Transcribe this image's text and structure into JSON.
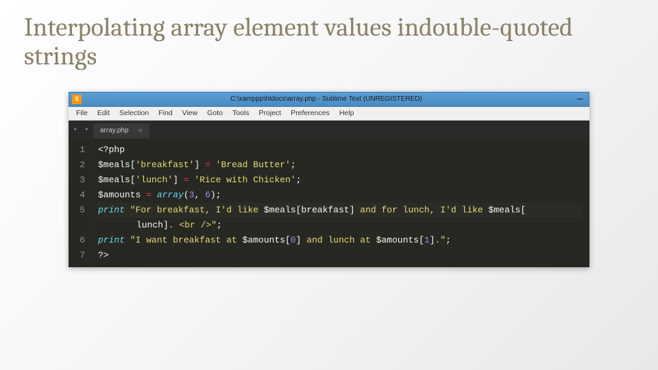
{
  "slide": {
    "title": "Interpolating array element values indouble-quoted strings"
  },
  "editor": {
    "titlebar": {
      "icon_label": "S",
      "path": "C:\\xamppp\\htdocs\\array.php - Sublime Text (UNREGISTERED)",
      "minimize": "—"
    },
    "menu": {
      "items": [
        "File",
        "Edit",
        "Selection",
        "Find",
        "View",
        "Goto",
        "Tools",
        "Project",
        "Preferences",
        "Help"
      ]
    },
    "tab": {
      "nav_prev": "◂",
      "nav_next": "▸",
      "name": "array.php",
      "close": "×"
    },
    "line_numbers": [
      "1",
      "2",
      "3",
      "4",
      "5",
      "",
      "6",
      "7"
    ],
    "code": {
      "l1_open": "<?php",
      "l2_var": "$meals",
      "l2_br_open": "[",
      "l2_key": "'breakfast'",
      "l2_br_close": "]",
      "l2_eq": " = ",
      "l2_val": "'Bread Butter'",
      "l2_semi": ";",
      "l3_var": "$meals",
      "l3_br_open": "[",
      "l3_key": "'lunch'",
      "l3_br_close": "]",
      "l3_eq": " = ",
      "l3_val": "'Rice with Chicken'",
      "l3_semi": ";",
      "l4_var": "$amounts",
      "l4_eq": " = ",
      "l4_func": "array",
      "l4_paren_open": "(",
      "l4_n1": "3",
      "l4_comma": ", ",
      "l4_n2": "6",
      "l4_paren_close": ")",
      "l4_semi": ";",
      "l5_print": "print ",
      "l5_s1": "\"For breakfast, I'd like ",
      "l5_i1": "$meals[",
      "l5_k1": "breakfast",
      "l5_i1b": "]",
      "l5_s2": " and for lunch, I'd like ",
      "l5_i2": "$meals[",
      "l5w_k2": "lunch",
      "l5w_i2b": "]",
      "l5w_s3": ". <br />\"",
      "l5w_semi": ";",
      "l6_print": "print ",
      "l6_s1": "\"I want breakfast at ",
      "l6_i1": "$amounts[",
      "l6_n1": "0",
      "l6_i1b": "]",
      "l6_s2": " and lunch at ",
      "l6_i2": "$amounts[",
      "l6_n2": "1",
      "l6_i2b": "]",
      "l6_s3": ".\"",
      "l6_semi": ";",
      "l7_close": "?>"
    }
  }
}
